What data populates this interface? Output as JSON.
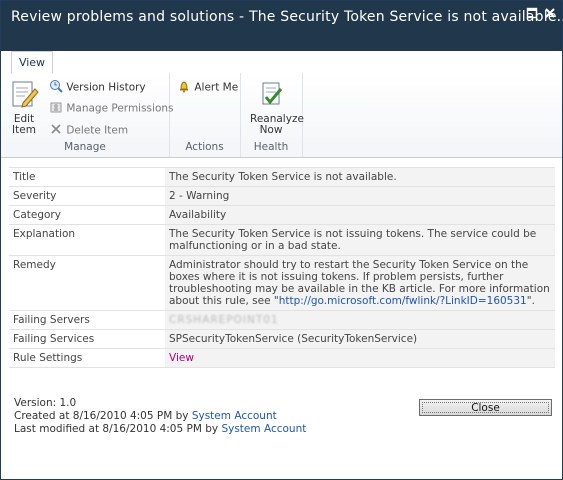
{
  "window": {
    "title": "Review problems and solutions - The Security Token Service is not available...."
  },
  "ribbon": {
    "tab_label": "View",
    "groups": {
      "manage": {
        "label": "Manage",
        "edit_item": "Edit Item",
        "version_history": "Version History",
        "manage_permissions": "Manage Permissions",
        "delete_item": "Delete Item"
      },
      "actions": {
        "label": "Actions",
        "alert_me": "Alert Me"
      },
      "health": {
        "label": "Health",
        "reanalyze_now": "Reanalyze Now"
      }
    }
  },
  "details": {
    "title": {
      "label": "Title",
      "value": "The Security Token Service is not available."
    },
    "severity": {
      "label": "Severity",
      "value": "2 - Warning"
    },
    "category": {
      "label": "Category",
      "value": "Availability"
    },
    "explanation": {
      "label": "Explanation",
      "value": "The Security Token Service is not issuing tokens. The service could be malfunctioning or in a bad state."
    },
    "remedy": {
      "label": "Remedy",
      "value_prefix": "Administrator should try to restart the Security Token Service on the boxes where it is not issuing tokens. If problem persists, further troubleshooting may be available in the KB article. For more information about this rule, see \"",
      "link": "http://go.microsoft.com/fwlink/?LinkID=160531",
      "value_suffix": "\"."
    },
    "failing_servers": {
      "label": "Failing Servers",
      "value": "CRSHAREPOINT01"
    },
    "failing_services": {
      "label": "Failing Services",
      "value": "SPSecurityTokenService (SecurityTokenService)"
    },
    "rule_settings": {
      "label": "Rule Settings",
      "value": "View"
    }
  },
  "footer": {
    "version": "Version: 1.0",
    "created_prefix": "Created at 8/16/2010 4:05 PM  by ",
    "created_by": "System Account",
    "modified_prefix": "Last modified at 8/16/2010 4:05 PM  by ",
    "modified_by": "System Account"
  },
  "buttons": {
    "close": "Close"
  },
  "colors": {
    "titlebar": "#21374c",
    "link": "#1f56b3",
    "view_link": "#b30078"
  }
}
